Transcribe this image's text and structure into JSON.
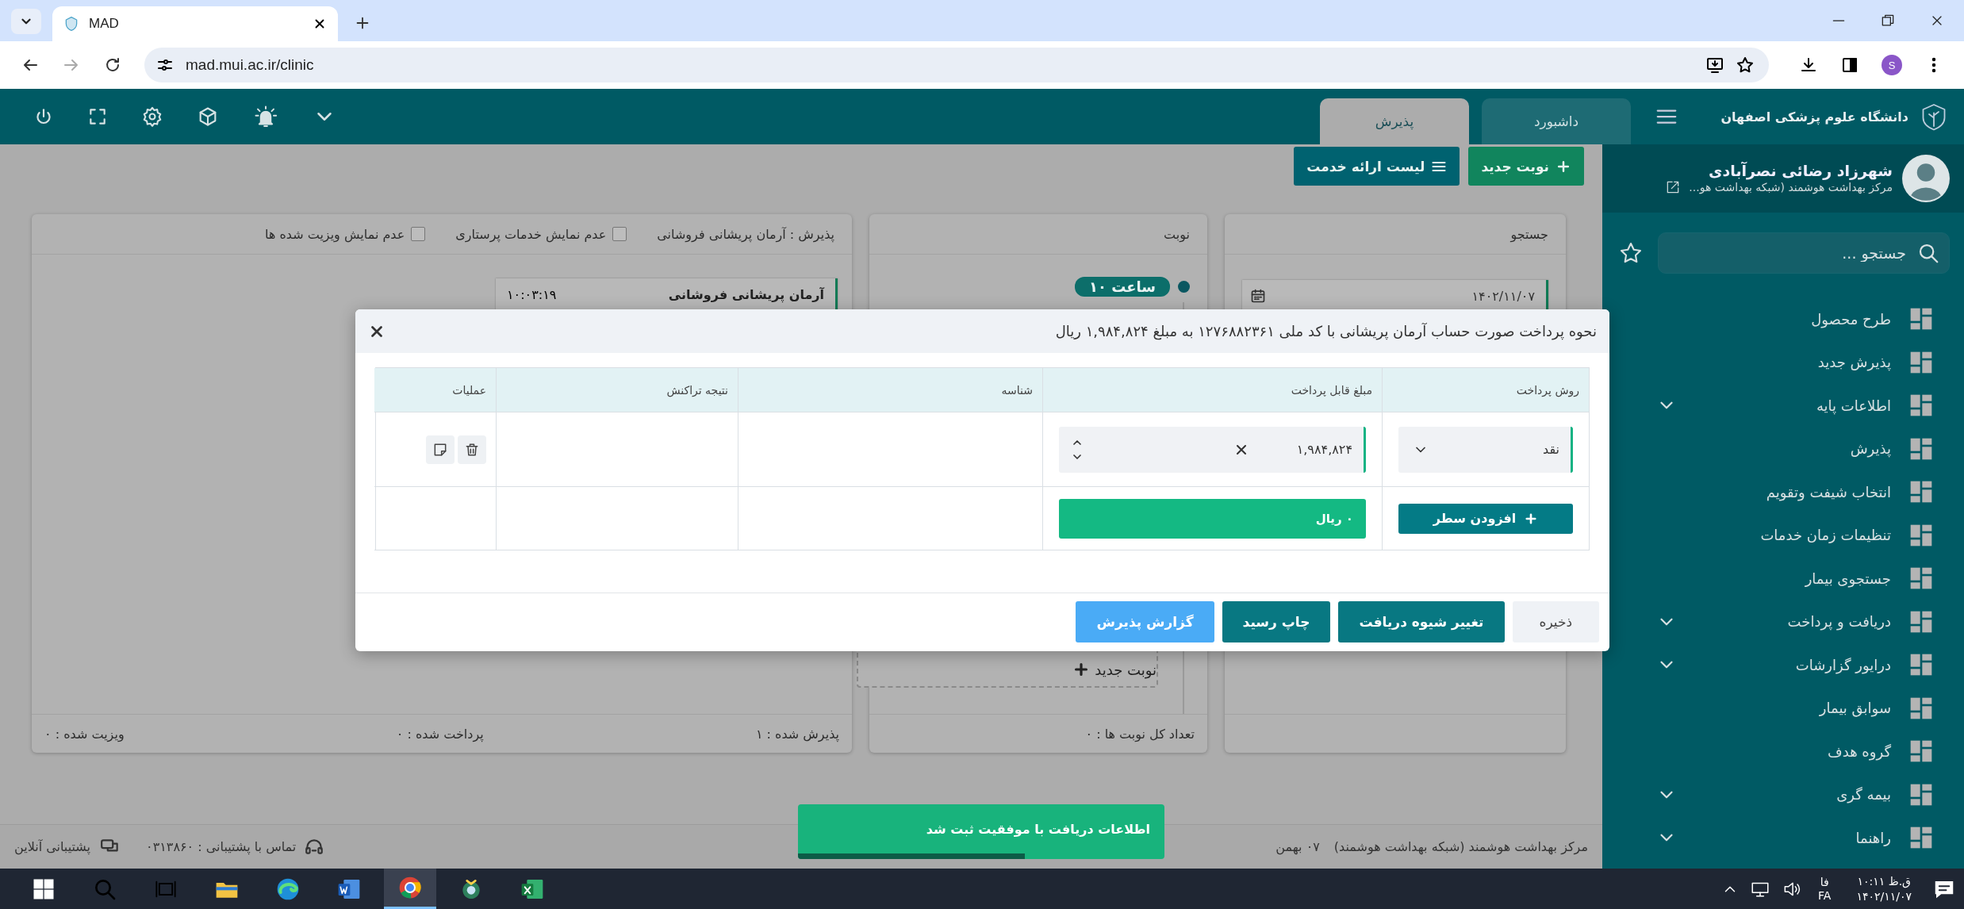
{
  "browser": {
    "tab": {
      "title": "MAD"
    },
    "nav": [
      {
        "kind": "back",
        "disabled": false
      },
      {
        "kind": "forward",
        "disabled": true
      },
      {
        "kind": "reload",
        "disabled": false
      }
    ],
    "url": "mad.mui.ac.ir/clinic",
    "profile": "S"
  },
  "header": {
    "org": "دانشگاه علوم پزشکی اصفهان",
    "tabs": [
      {
        "label": "داشبورد",
        "selected": false
      },
      {
        "label": "پذیرش",
        "selected": true
      }
    ]
  },
  "toolbar": [
    {
      "label": "نوبت جدید",
      "kind": "add"
    },
    {
      "label": "لیست ارائه خدمت",
      "kind": "list"
    }
  ],
  "search_panel": {
    "title": "جستجو",
    "date": "۱۴۰۲/۱۱/۰۷"
  },
  "queue_panel": {
    "title": "نوبت",
    "hour": "ساعت ۱۰",
    "new_label": "نوبت جدید",
    "footer": "تعداد کل نوبت ها : ۰"
  },
  "reception_panel": {
    "title": "پذیرش : آرمان پریشانی فروشانی",
    "checkboxes": [
      {
        "label": "عدم نمایش خدمات پرستاری",
        "checked": false
      },
      {
        "label": "عدم نمایش ویزیت شده ها",
        "checked": false
      }
    ],
    "card": {
      "name": "آرمان پریشانی فروشانی",
      "time": "۱۰:۰۳:۱۹"
    },
    "stats": [
      "پذیرش شده : ۱",
      "پرداخت شده : ۰",
      "ویزیت شده : ۰"
    ]
  },
  "footer": {
    "center": "مرکز بهداشت هوشمند (شبکه بهداشت هوشمند)",
    "date": "۰۷ بهمن",
    "support_phone": "تماس با پشتیبانی : ۰۳۱۳۸۶۰",
    "online_support": "پشتیبانی آنلاین"
  },
  "sidebar": {
    "user": "شهرزاد رضائی نصرآبادی",
    "org": "مرکز بهداشت هوشمند (شبکه بهداشت هو...",
    "search": {
      "placeholder": "جستجو ..."
    },
    "items": [
      {
        "label": "طرح محصول",
        "submenu": false
      },
      {
        "label": "پذیرش جدید",
        "submenu": false
      },
      {
        "label": "اطلاعات پایه",
        "submenu": true
      },
      {
        "label": "پذیرش",
        "submenu": false
      },
      {
        "label": "انتخاب شیفت وتقویم",
        "submenu": false
      },
      {
        "label": "تنظیمات زمان خدمات",
        "submenu": false
      },
      {
        "label": "جستجوی بیمار",
        "submenu": false
      },
      {
        "label": "دریافت و پرداخت",
        "submenu": true
      },
      {
        "label": "درایور گزارشات",
        "submenu": true
      },
      {
        "label": "سوابق بیمار",
        "submenu": false
      },
      {
        "label": "گروه هدف",
        "submenu": false
      },
      {
        "label": "بیمه گری",
        "submenu": true
      },
      {
        "label": "راهنما",
        "submenu": true
      }
    ]
  },
  "modal": {
    "title": "نحوه پرداخت صورت حساب آرمان پریشانی با کد ملی ۱۲۷۶۸۸۲۳۶۱ به مبلغ ۱,۹۸۴,۸۲۴ ریال",
    "columns": [
      "روش پرداخت",
      "مبلغ قابل پرداخت",
      "شناسه",
      "نتیجه تراکنش",
      "عملیات"
    ],
    "row": {
      "method": "نقد",
      "amount": "۱,۹۸۴,۸۲۴"
    },
    "add_row": "افزودن سطر",
    "total": "۰ ریال",
    "buttons": [
      {
        "label": "ذخیره",
        "kind": "plain"
      },
      {
        "label": "تغییر شیوه دریافت",
        "kind": "primary"
      },
      {
        "label": "چاپ رسید",
        "kind": "primary"
      },
      {
        "label": "گزارش پذیرش",
        "kind": "info"
      }
    ]
  },
  "toast": {
    "text": "اطلاعات دریافت با موفقیت ثبت شد",
    "level": 0.62
  },
  "taskbar": {
    "apps": [
      {
        "kind": "explorer",
        "selected": false
      },
      {
        "kind": "edge",
        "selected": false
      },
      {
        "kind": "word",
        "selected": false
      },
      {
        "kind": "chrome",
        "selected": true
      },
      {
        "kind": "app",
        "selected": false
      },
      {
        "kind": "excel",
        "selected": false
      }
    ],
    "lang": "فا",
    "lang_code": "FA",
    "time": "ق.ظ ۱۰:۱۱",
    "date": "۱۴۰۲/۱۱/۰۷"
  }
}
